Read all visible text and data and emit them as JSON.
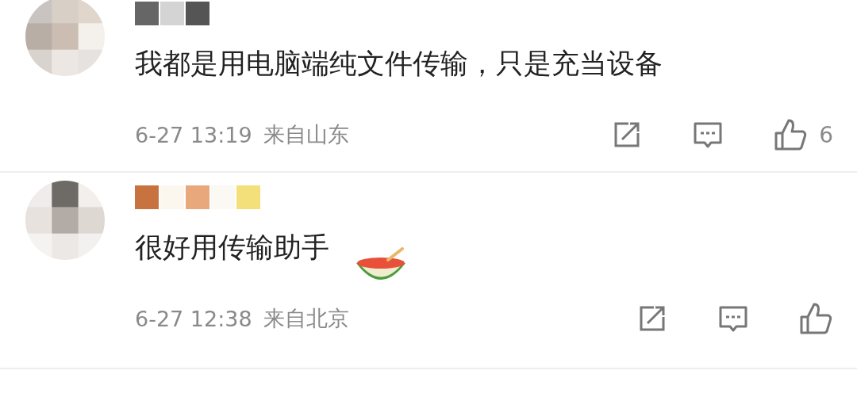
{
  "comments": [
    {
      "text": "我都是用电脑端纯文件传输，只是充当设备",
      "time": "6-27 13:19",
      "location": "来自山东",
      "likes": "6",
      "emoji": false
    },
    {
      "text": "很好用传输助手",
      "time": "6-27 12:38",
      "location": "来自北京",
      "emoji": true
    }
  ]
}
